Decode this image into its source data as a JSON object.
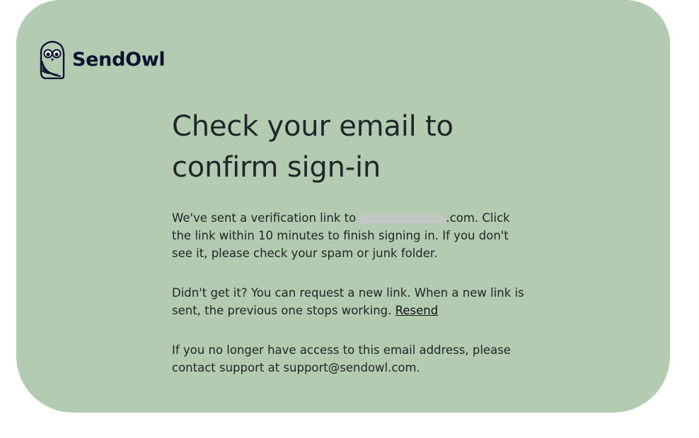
{
  "brand": {
    "name": "SendOwl",
    "logo_icon": "owl-logo-icon"
  },
  "heading": "Check your email to confirm sign-in",
  "paragraph1": {
    "prefix": "We've sent a verification link to ",
    "email_suffix": ".com",
    "suffix": ". Click the link within 10 minutes to finish signing in. If you don't see it, please check your spam or junk folder."
  },
  "paragraph2": {
    "text": "Didn't get it? You can request a new link. When a new link is sent, the previous one stops working. ",
    "resend_label": "Resend"
  },
  "paragraph3": {
    "text": "If you no longer have access to this email address, please contact support at support@sendowl.com."
  },
  "colors": {
    "card_background": "#b3cbb0",
    "text": "#22262a",
    "brand_text": "#0b1330"
  }
}
